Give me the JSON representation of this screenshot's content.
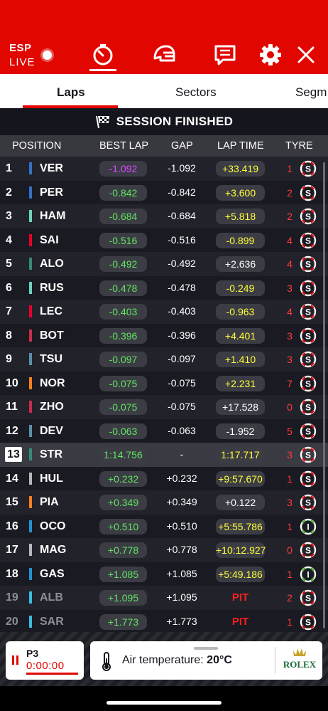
{
  "header": {
    "country": "ESP",
    "live_label": "LIVE",
    "icons": [
      "timer-icon",
      "helmet-icon",
      "chat-icon",
      "settings-icon",
      "close-icon"
    ]
  },
  "tabs": [
    {
      "label": "Laps",
      "active": true
    },
    {
      "label": "Sectors",
      "active": false
    },
    {
      "label": "Segm",
      "active": false
    }
  ],
  "banner": {
    "text": "SESSION FINISHED",
    "icon": "checkered-flag-icon"
  },
  "columns": {
    "position": "POSITION",
    "best_lap": "BEST LAP",
    "gap": "GAP",
    "lap_time": "LAP TIME",
    "tyre": "TYRE"
  },
  "rows": [
    {
      "pos": "1",
      "driver": "VER",
      "team_color": "#3671c6",
      "best": "-1.092",
      "best_style": "purple",
      "gap": "-1.092",
      "lap": "+33.419",
      "lap_style": "yellow",
      "tyre_laps": "1",
      "tyre_compound": "S",
      "tyre_color": "#e10600"
    },
    {
      "pos": "2",
      "driver": "PER",
      "team_color": "#3671c6",
      "best": "-0.842",
      "best_style": "green",
      "gap": "-0.842",
      "lap": "+3.600",
      "lap_style": "yellow",
      "tyre_laps": "2",
      "tyre_compound": "S",
      "tyre_color": "#e10600"
    },
    {
      "pos": "3",
      "driver": "HAM",
      "team_color": "#6cd3bf",
      "best": "-0.684",
      "best_style": "green",
      "gap": "-0.684",
      "lap": "+5.818",
      "lap_style": "yellow",
      "tyre_laps": "2",
      "tyre_compound": "S",
      "tyre_color": "#e10600"
    },
    {
      "pos": "4",
      "driver": "SAI",
      "team_color": "#e8002d",
      "best": "-0.516",
      "best_style": "green",
      "gap": "-0.516",
      "lap": "-0.899",
      "lap_style": "yellow",
      "tyre_laps": "4",
      "tyre_compound": "S",
      "tyre_color": "#e10600"
    },
    {
      "pos": "5",
      "driver": "ALO",
      "team_color": "#358c75",
      "best": "-0.492",
      "best_style": "green",
      "gap": "-0.492",
      "lap": "+2.636",
      "lap_style": "white",
      "tyre_laps": "4",
      "tyre_compound": "S",
      "tyre_color": "#e10600"
    },
    {
      "pos": "6",
      "driver": "RUS",
      "team_color": "#6cd3bf",
      "best": "-0.478",
      "best_style": "green",
      "gap": "-0.478",
      "lap": "-0.249",
      "lap_style": "yellow",
      "tyre_laps": "3",
      "tyre_compound": "S",
      "tyre_color": "#e10600"
    },
    {
      "pos": "7",
      "driver": "LEC",
      "team_color": "#e8002d",
      "best": "-0.403",
      "best_style": "green",
      "gap": "-0.403",
      "lap": "-0.963",
      "lap_style": "yellow",
      "tyre_laps": "4",
      "tyre_compound": "S",
      "tyre_color": "#e10600"
    },
    {
      "pos": "8",
      "driver": "BOT",
      "team_color": "#c92d4b",
      "best": "-0.396",
      "best_style": "green",
      "gap": "-0.396",
      "lap": "+4.401",
      "lap_style": "yellow",
      "tyre_laps": "3",
      "tyre_compound": "S",
      "tyre_color": "#e10600"
    },
    {
      "pos": "9",
      "driver": "TSU",
      "team_color": "#5e8faa",
      "best": "-0.097",
      "best_style": "green",
      "gap": "-0.097",
      "lap": "+1.410",
      "lap_style": "yellow",
      "tyre_laps": "3",
      "tyre_compound": "S",
      "tyre_color": "#e10600"
    },
    {
      "pos": "10",
      "driver": "NOR",
      "team_color": "#f58020",
      "best": "-0.075",
      "best_style": "green",
      "gap": "-0.075",
      "lap": "+2.231",
      "lap_style": "yellow",
      "tyre_laps": "7",
      "tyre_compound": "S",
      "tyre_color": "#e10600"
    },
    {
      "pos": "11",
      "driver": "ZHO",
      "team_color": "#c92d4b",
      "best": "-0.075",
      "best_style": "green",
      "gap": "-0.075",
      "lap": "+17.528",
      "lap_style": "white",
      "tyre_laps": "0",
      "tyre_compound": "S",
      "tyre_color": "#e10600"
    },
    {
      "pos": "12",
      "driver": "DEV",
      "team_color": "#5e8faa",
      "best": "-0.063",
      "best_style": "green",
      "gap": "-0.063",
      "lap": "-1.952",
      "lap_style": "white",
      "tyre_laps": "5",
      "tyre_compound": "S",
      "tyre_color": "#e10600"
    },
    {
      "pos": "13",
      "driver": "STR",
      "team_color": "#358c75",
      "best": "1:14.756",
      "best_style": "green",
      "gap": "-",
      "lap": "1:17.717",
      "lap_style": "yellow",
      "tyre_laps": "3",
      "tyre_compound": "S",
      "tyre_color": "#e10600",
      "highlight": true
    },
    {
      "pos": "14",
      "driver": "HUL",
      "team_color": "#b6babd",
      "best": "+0.232",
      "best_style": "green",
      "gap": "+0.232",
      "lap": "+9:57.670",
      "lap_style": "yellow",
      "tyre_laps": "1",
      "tyre_compound": "S",
      "tyre_color": "#e10600"
    },
    {
      "pos": "15",
      "driver": "PIA",
      "team_color": "#f58020",
      "best": "+0.349",
      "best_style": "green",
      "gap": "+0.349",
      "lap": "+0.122",
      "lap_style": "white",
      "tyre_laps": "3",
      "tyre_compound": "S",
      "tyre_color": "#e10600"
    },
    {
      "pos": "16",
      "driver": "OCO",
      "team_color": "#2293d1",
      "best": "+0.510",
      "best_style": "green",
      "gap": "+0.510",
      "lap": "+5:55.786",
      "lap_style": "yellow",
      "tyre_laps": "1",
      "tyre_compound": "I",
      "tyre_color": "#43b02a"
    },
    {
      "pos": "17",
      "driver": "MAG",
      "team_color": "#b6babd",
      "best": "+0.778",
      "best_style": "green",
      "gap": "+0.778",
      "lap": "+10:12.927",
      "lap_style": "yellow",
      "tyre_laps": "0",
      "tyre_compound": "S",
      "tyre_color": "#e10600"
    },
    {
      "pos": "18",
      "driver": "GAS",
      "team_color": "#2293d1",
      "best": "+1.085",
      "best_style": "green",
      "gap": "+1.085",
      "lap": "+5:49.186",
      "lap_style": "yellow",
      "tyre_laps": "1",
      "tyre_compound": "I",
      "tyre_color": "#43b02a"
    },
    {
      "pos": "19",
      "driver": "ALB",
      "team_color": "#37bedd",
      "best": "+1.095",
      "best_style": "green",
      "gap": "+1.095",
      "lap": "PIT",
      "lap_style": "pit",
      "tyre_laps": "2",
      "tyre_compound": "S",
      "tyre_color": "#e10600",
      "dim": true
    },
    {
      "pos": "20",
      "driver": "SAR",
      "team_color": "#37bedd",
      "best": "+1.773",
      "best_style": "green",
      "gap": "+1.773",
      "lap": "PIT",
      "lap_style": "pit",
      "tyre_laps": "1",
      "tyre_compound": "S",
      "tyre_color": "#e10600",
      "dim": true
    }
  ],
  "session_card": {
    "label": "P3",
    "time": "0:00:00"
  },
  "air": {
    "label": "Air temperature:",
    "value": "20°C"
  },
  "sponsor": {
    "name": "ROLEX"
  },
  "colors": {
    "brand_red": "#e10600",
    "purple": "#bf40ff",
    "green": "#39e639",
    "yellow": "#ffff33",
    "background": "#15151e"
  }
}
